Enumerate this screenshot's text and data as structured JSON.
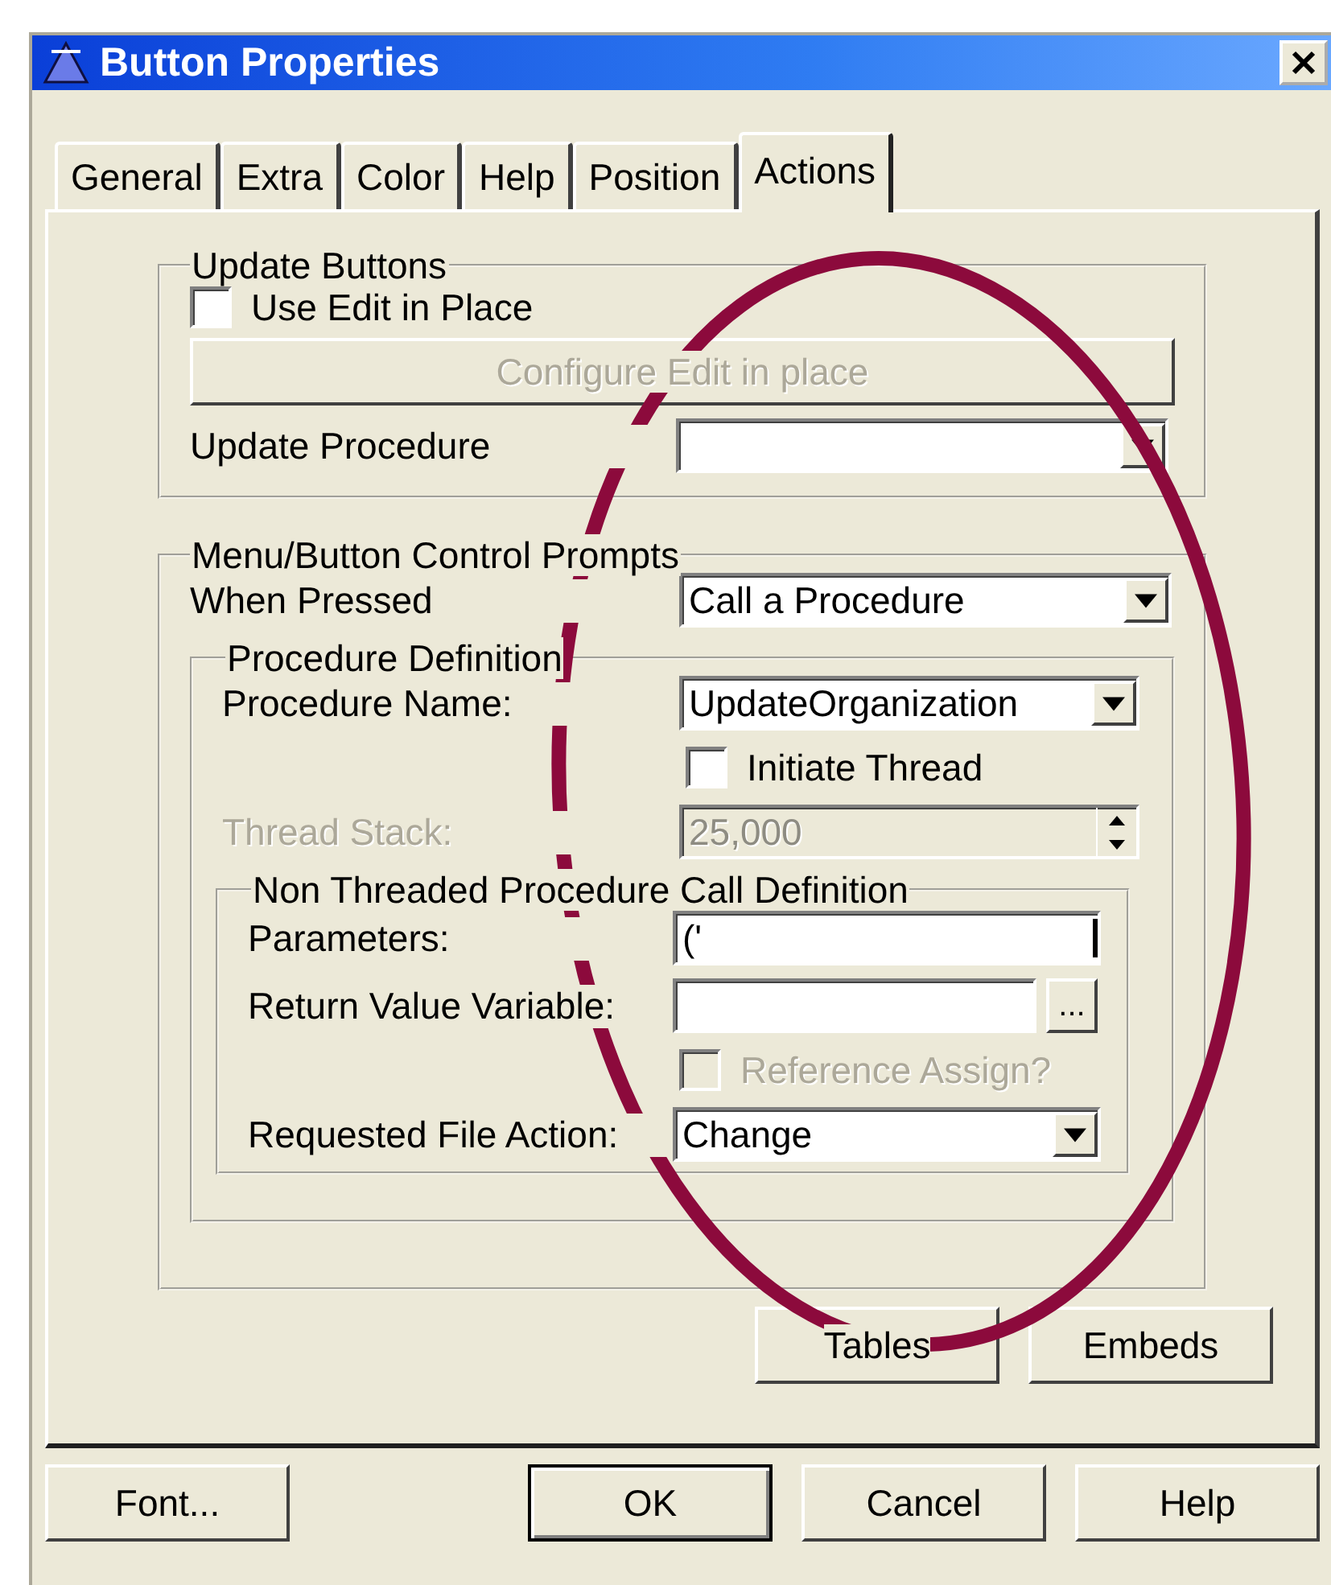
{
  "window": {
    "title": "Button Properties"
  },
  "tabs": [
    {
      "label": "General",
      "selected": false
    },
    {
      "label": "Extra",
      "selected": false
    },
    {
      "label": "Color",
      "selected": false
    },
    {
      "label": "Help",
      "selected": false
    },
    {
      "label": "Position",
      "selected": false
    },
    {
      "label": "Actions",
      "selected": true
    }
  ],
  "update_buttons": {
    "title": "Update Buttons",
    "use_edit_in_place": {
      "label": "Use Edit in Place",
      "checked": false
    },
    "configure_button": {
      "label": "Configure Edit in place",
      "disabled": true
    },
    "update_procedure": {
      "label": "Update Procedure"
    }
  },
  "prompts": {
    "title": "Menu/Button Control Prompts",
    "when_pressed": {
      "label": "When Pressed",
      "value": "Call a Procedure"
    },
    "procedure_definition": {
      "title": "Procedure Definition",
      "procedure_name": {
        "label": "Procedure Name:",
        "value": "UpdateOrganization"
      },
      "initiate_thread": {
        "label": "Initiate Thread",
        "checked": false
      },
      "thread_stack": {
        "label": "Thread Stack:",
        "value": "25,000",
        "disabled": true
      },
      "non_threaded": {
        "title": "Non Threaded Procedure Call Definition",
        "parameters": {
          "label": "Parameters:",
          "value": "('"
        },
        "return_value": {
          "label": "Return Value Variable:",
          "button": "..."
        },
        "reference_assign": {
          "label": "Reference Assign?",
          "checked": false,
          "disabled": true
        },
        "file_action": {
          "label": "Requested File Action:",
          "value": "Change"
        }
      }
    }
  },
  "side_buttons": [
    {
      "label": "Tables"
    },
    {
      "label": "Embeds"
    }
  ],
  "footer_buttons": [
    {
      "label": "Font...",
      "default": false
    },
    {
      "label": "OK",
      "default": true
    },
    {
      "label": "Cancel",
      "default": false
    },
    {
      "label": "Help",
      "default": false
    }
  ]
}
